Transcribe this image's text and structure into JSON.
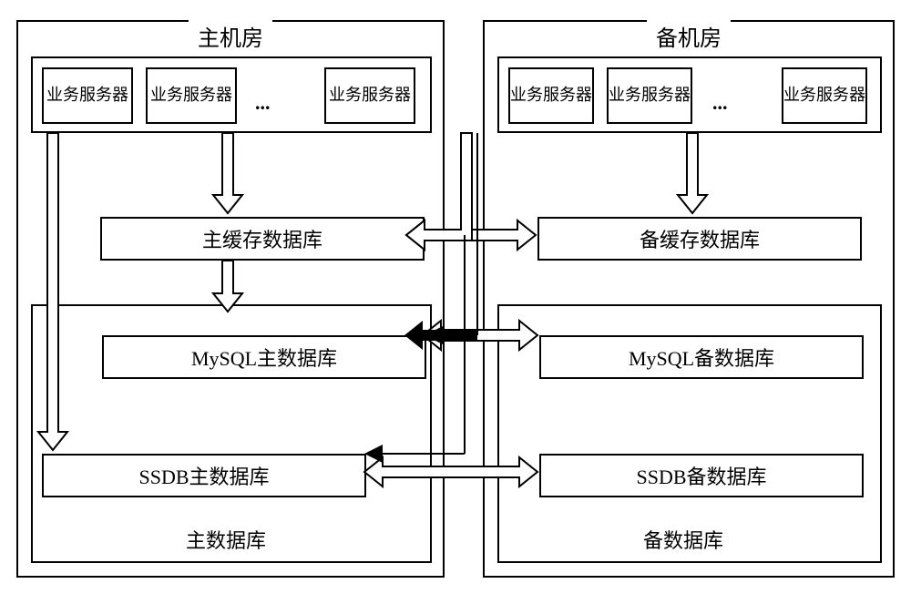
{
  "primary_room": {
    "title": "主机房",
    "service_servers": [
      "业务服务器",
      "业务服务器",
      "业务服务器"
    ],
    "cache_db": "主缓存数据库",
    "mysql_db": "MySQL主数据库",
    "ssdb_db": "SSDB主数据库",
    "db_group_label": "主数据库"
  },
  "backup_room": {
    "title": "备机房",
    "service_servers": [
      "业务服务器",
      "业务服务器",
      "业务服务器"
    ],
    "cache_db": "备缓存数据库",
    "mysql_db": "MySQL备数据库",
    "ssdb_db": "SSDB备数据库",
    "db_group_label": "备数据库"
  },
  "ellipsis": "...",
  "diagram_description": "Architecture diagram showing primary (主) and backup (备) data center rooms. Each room contains business service servers, a cache database layer, and a main database group (MySQL + SSDB). Bidirectional hollow arrows indicate data flow between corresponding components across rooms and within rooms."
}
